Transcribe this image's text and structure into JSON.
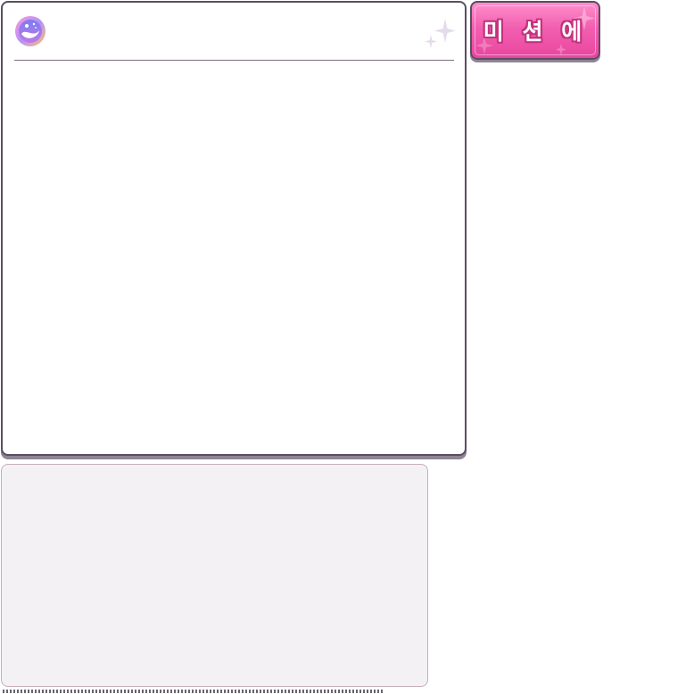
{
  "tab_button": {
    "label": "미 션 에",
    "color": "#f25fb0",
    "outline_color": "#c2337f",
    "icon": "sparkle-icon"
  },
  "main_panel": {
    "emblem_icon": "yin-yang-emblem-icon",
    "decor_icon": "sparkle-icon",
    "border_color": "#5a4d62"
  },
  "lower_box": {
    "background": "#f4f1f5"
  }
}
